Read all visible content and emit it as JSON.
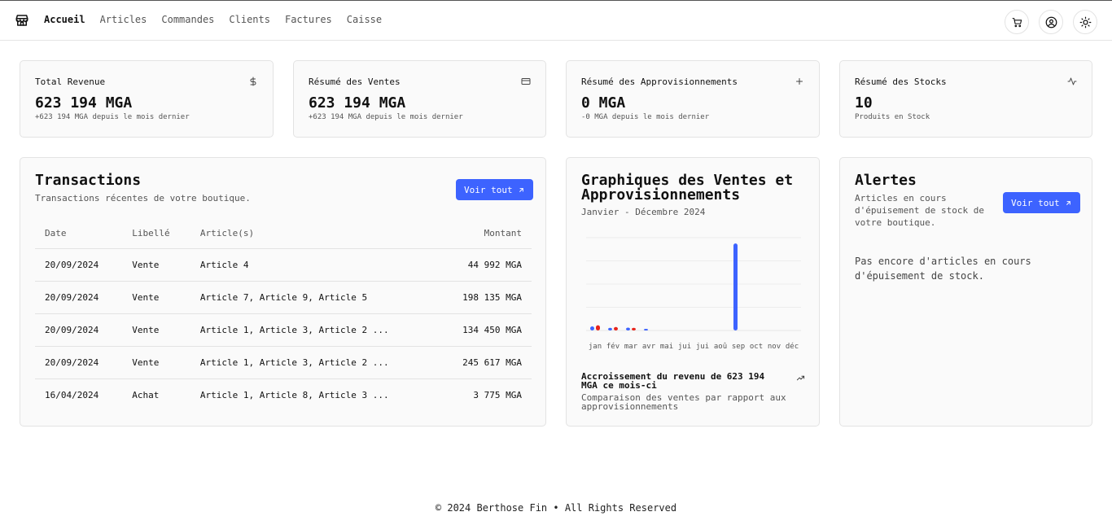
{
  "nav": {
    "items": [
      {
        "label": "Accueil",
        "active": true
      },
      {
        "label": "Articles",
        "active": false
      },
      {
        "label": "Commandes",
        "active": false
      },
      {
        "label": "Clients",
        "active": false
      },
      {
        "label": "Factures",
        "active": false
      },
      {
        "label": "Caisse",
        "active": false
      }
    ],
    "icons": [
      "store-icon",
      "cart-icon",
      "user-icon",
      "sun-icon"
    ]
  },
  "summary": [
    {
      "title": "Total Revenue",
      "value": "623 194 MGA",
      "sub": "+623 194 MGA depuis le mois dernier",
      "icon": "dollar-icon"
    },
    {
      "title": "Résumé des Ventes",
      "value": "623 194 MGA",
      "sub": "+623 194 MGA depuis le mois dernier",
      "icon": "credit-card-icon"
    },
    {
      "title": "Résumé des Approvisionnements",
      "value": "0 MGA",
      "sub": "-0 MGA depuis le mois dernier",
      "icon": "plus-icon"
    },
    {
      "title": "Résumé des Stocks",
      "value": "10",
      "sub": "Produits en Stock",
      "icon": "activity-icon"
    }
  ],
  "transactions": {
    "title": "Transactions",
    "desc": "Transactions récentes de votre boutique.",
    "button": "Voir tout",
    "columns": [
      "Date",
      "Libellé",
      "Article(s)",
      "Montant"
    ],
    "rows": [
      [
        "20/09/2024",
        "Vente",
        "Article 4",
        "44 992 MGA"
      ],
      [
        "20/09/2024",
        "Vente",
        "Article 7, Article 9, Article 5",
        "198 135 MGA"
      ],
      [
        "20/09/2024",
        "Vente",
        "Article 1, Article 3, Article 2 ...",
        "134 450 MGA"
      ],
      [
        "20/09/2024",
        "Vente",
        "Article 1, Article 3, Article 2 ...",
        "245 617 MGA"
      ],
      [
        "16/04/2024",
        "Achat",
        "Article 1, Article 8, Article 3 ...",
        "3 775 MGA"
      ]
    ]
  },
  "chart_card": {
    "title": "Graphiques des Ventes et Approvisionnements",
    "subtitle": "Janvier - Décembre 2024",
    "footer_title": "Accroissement du revenu de 623 194 MGA ce mois-ci",
    "footer_desc": "Comparaison des ventes par rapport aux approvisionnements"
  },
  "chart_data": {
    "type": "bar",
    "categories": [
      "jan",
      "fév",
      "mar",
      "avr",
      "mai",
      "jui",
      "jui",
      "aoû",
      "sep",
      "oct",
      "nov",
      "déc"
    ],
    "series": [
      {
        "color": "#3d63ff",
        "values": [
          14000,
          9000,
          10000,
          1500,
          0,
          0,
          0,
          0,
          300000,
          0,
          0,
          0
        ]
      },
      {
        "color": "#e8231b",
        "values": [
          18000,
          12000,
          9000,
          0,
          0,
          0,
          0,
          0,
          0,
          0,
          0,
          0
        ]
      }
    ],
    "grid": true,
    "ylim": [
      0,
      320000
    ]
  },
  "alerts": {
    "title": "Alertes",
    "desc": "Articles en cours d'épuisement de stock de votre boutique.",
    "button": "Voir tout",
    "empty": "Pas encore d'articles en cours d'épuisement de stock."
  },
  "footer": "© 2024 Berthose Fin • All Rights Reserved"
}
